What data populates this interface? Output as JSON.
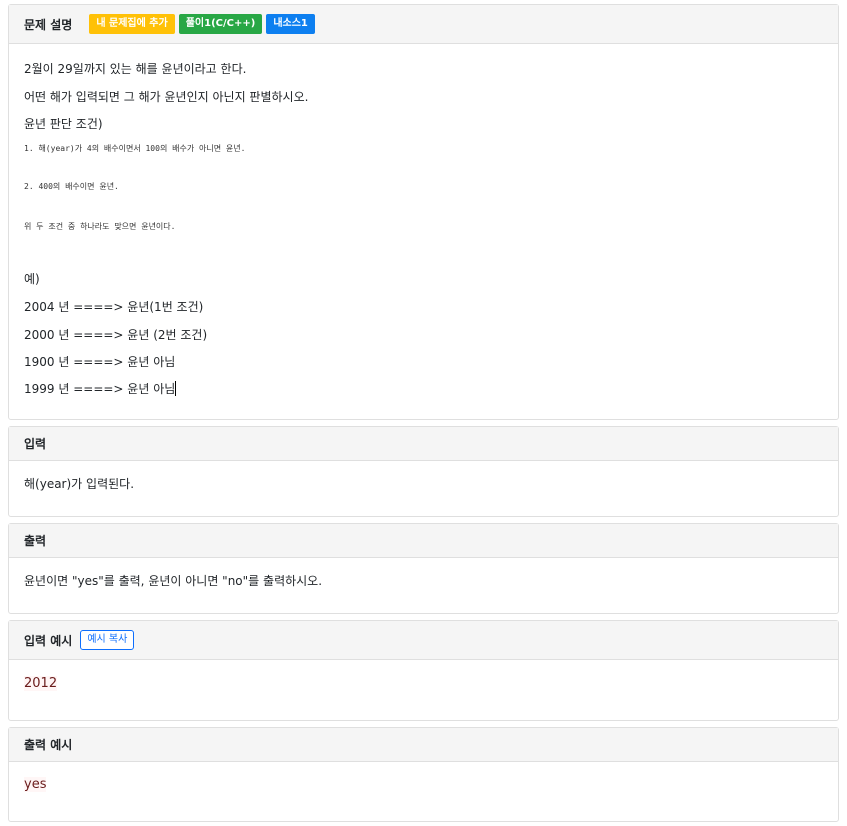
{
  "description": {
    "title": "문제 설명",
    "badges": [
      "내 문제집에 추가",
      "풀이1(C/C++)",
      "내소스1"
    ],
    "lines": [
      "2월이 29일까지 있는 해를 윤년이라고 한다.",
      "어떤 해가 입력되면 그 해가 윤년인지 아닌지 판별하시오.",
      "윤년 판단 조건)"
    ],
    "conditions": [
      "1. 해(year)가 4의 배수이면서 100의 배수가 아니면 윤년.",
      "2. 400의 배수이면 윤년.",
      "위 두 조건 중 하나라도 맞으면 윤년이다."
    ],
    "example_title": "예)",
    "examples": [
      "2004 년 ====>  윤년(1번 조건)",
      "2000 년 ====> 윤년 (2번 조건)",
      "1900 년 ====> 윤년 아님",
      "1999 년 ====> 윤년 아님"
    ]
  },
  "input": {
    "title": "입력",
    "text": "해(year)가 입력된다."
  },
  "output": {
    "title": "출력",
    "text": "윤년이면 \"yes\"를 출력, 윤년이 아니면 \"no\"를 출력하시오."
  },
  "input_example": {
    "title": "입력 예시",
    "copy_label": "예시 복사",
    "value": "2012"
  },
  "output_example": {
    "title": "출력 예시",
    "value": "yes"
  }
}
